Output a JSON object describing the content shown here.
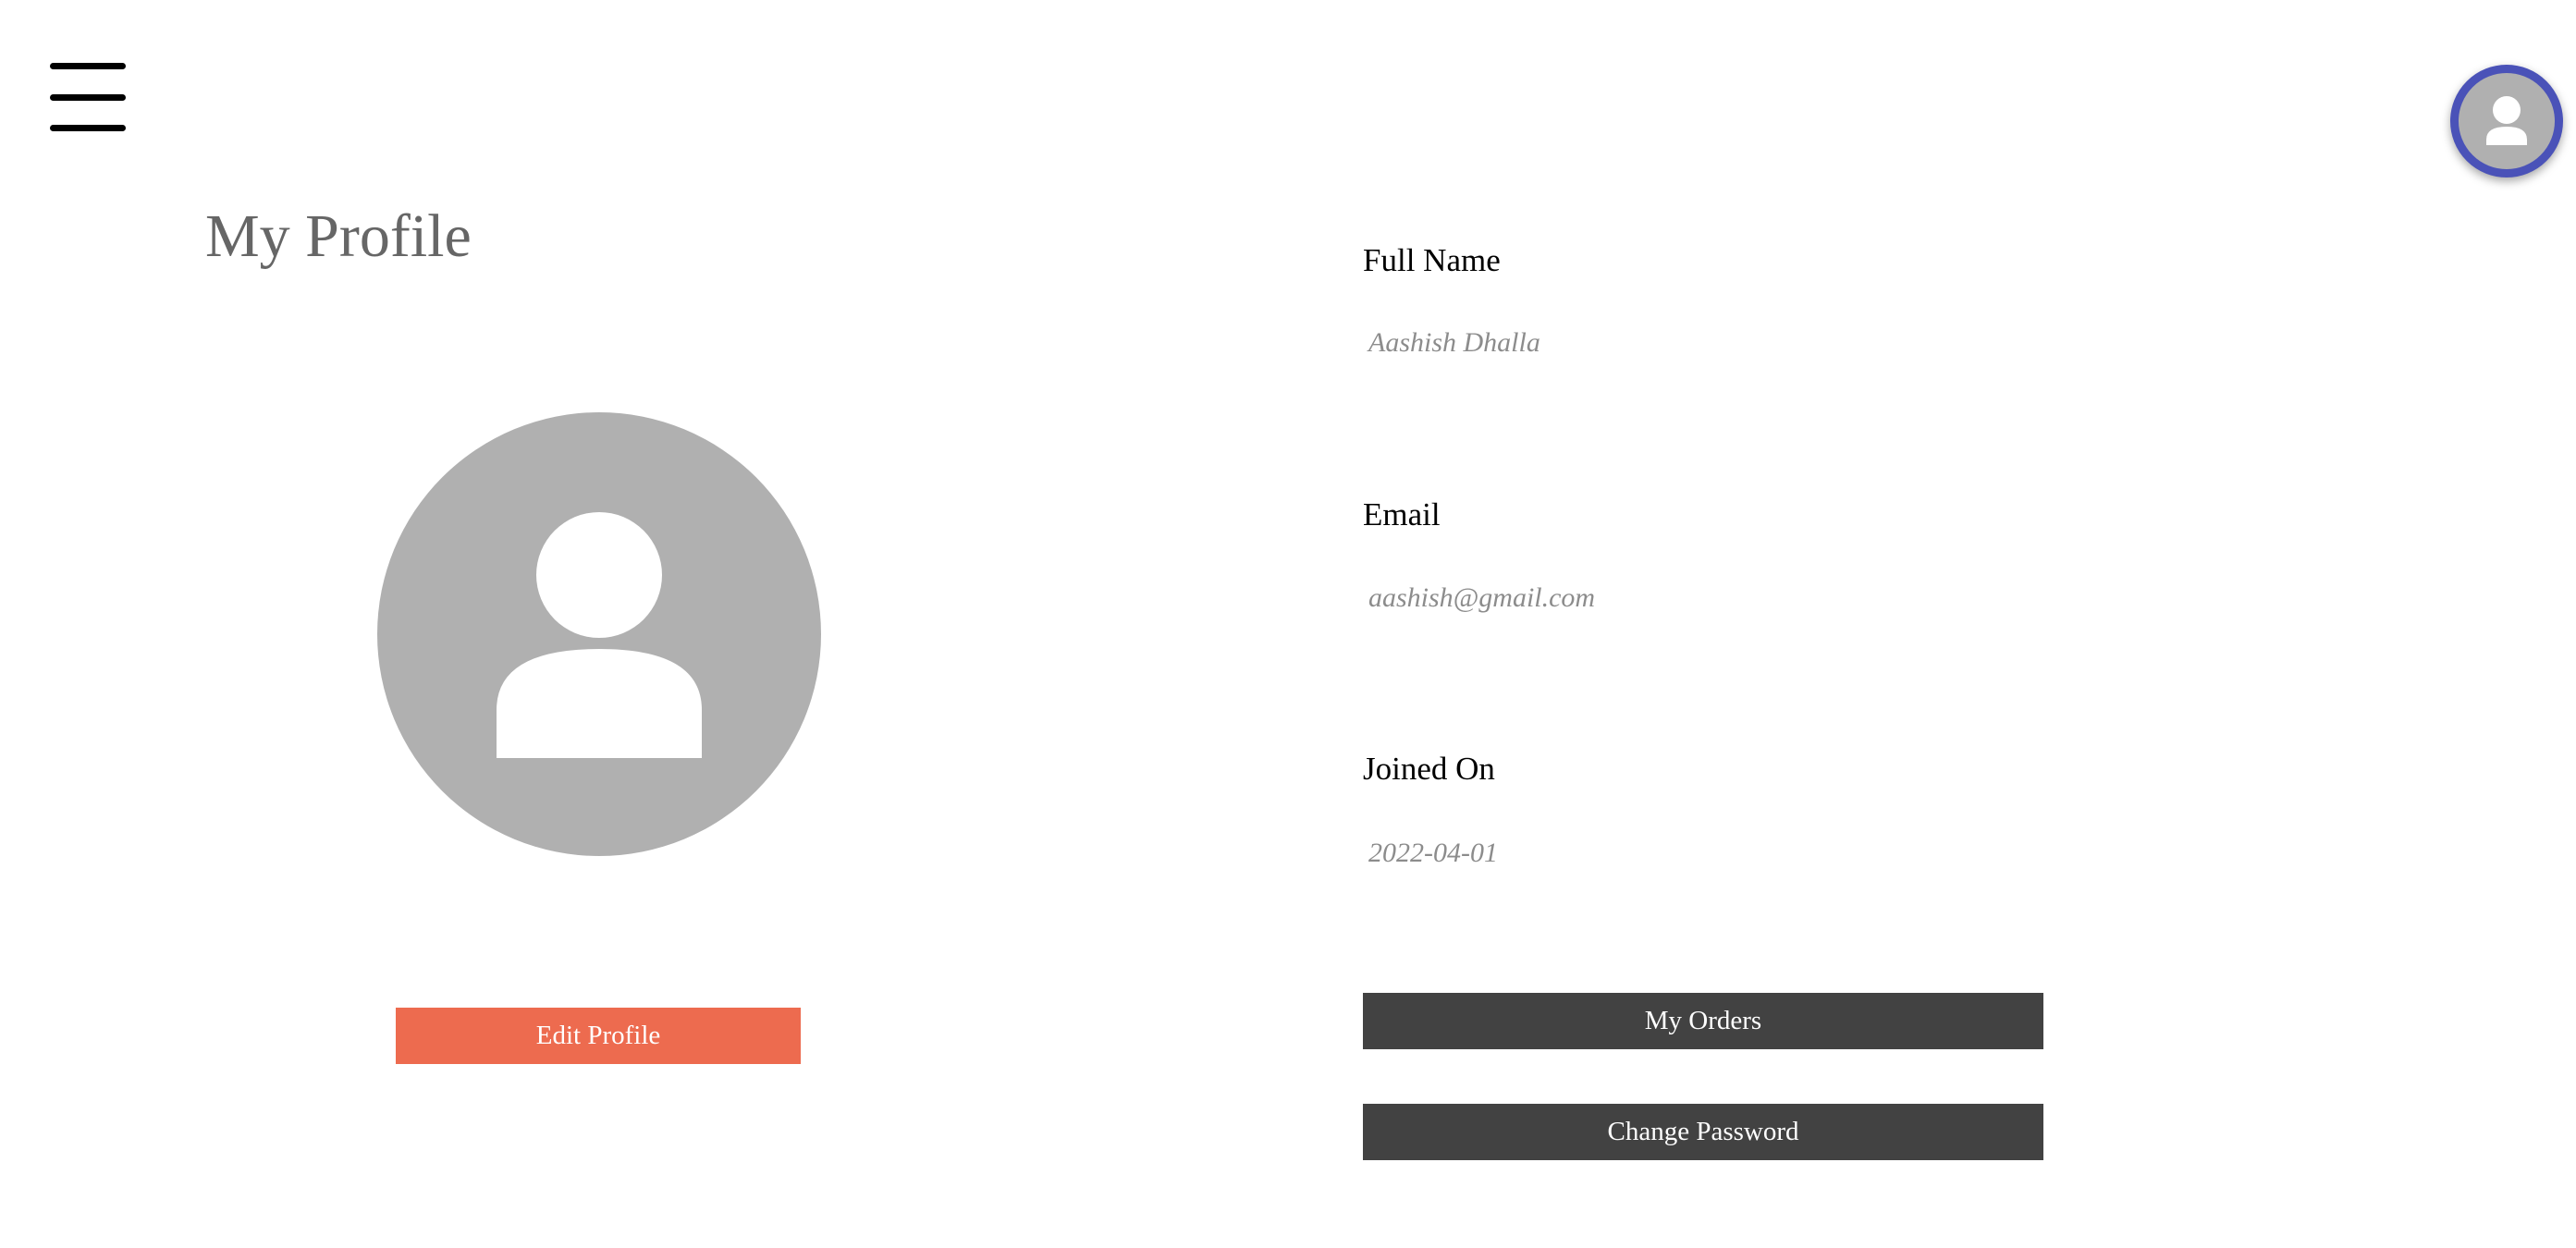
{
  "nav": {
    "menu_icon": "hamburger-menu-icon",
    "account_icon": "user-avatar-icon"
  },
  "profile": {
    "title": "My Profile",
    "photo_icon": "user-placeholder-icon",
    "edit_label": "Edit Profile"
  },
  "fields": {
    "full_name": {
      "label": "Full Name",
      "value": "Aashish Dhalla"
    },
    "email": {
      "label": "Email",
      "value": "aashish@gmail.com"
    },
    "joined_on": {
      "label": "Joined On",
      "value": "2022-04-01"
    }
  },
  "actions": {
    "orders_label": "My Orders",
    "password_label": "Change Password"
  },
  "colors": {
    "edit_button": "#ed6b4f",
    "action_button": "#424242",
    "avatar_ring": "#4a52b8",
    "avatar_fill": "#b0b0b0",
    "title_text": "#666666",
    "value_text": "#8c8c8c"
  }
}
